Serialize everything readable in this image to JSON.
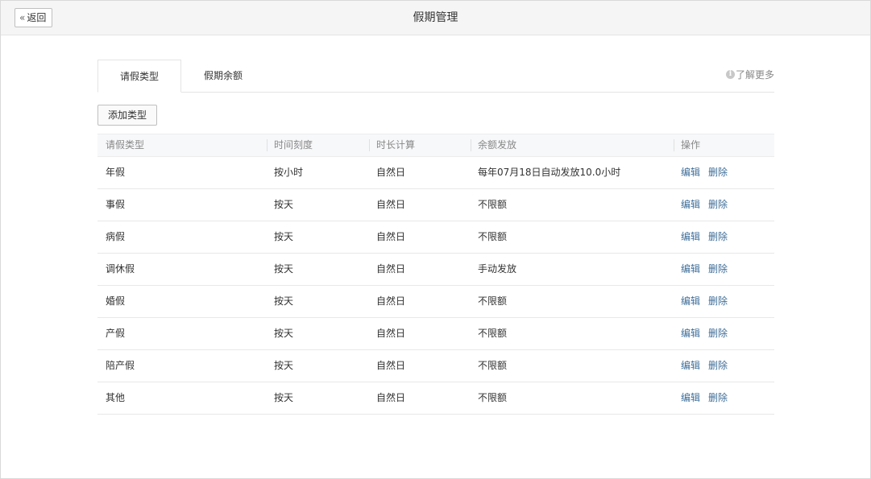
{
  "header": {
    "back_label": "返回",
    "title": "假期管理"
  },
  "tabs": [
    {
      "label": "请假类型",
      "active": true
    },
    {
      "label": "假期余额",
      "active": false
    }
  ],
  "learn_more": "了解更多",
  "add_type_label": "添加类型",
  "table": {
    "columns": [
      "请假类型",
      "时间刻度",
      "时长计算",
      "余额发放",
      "操作"
    ],
    "rows": [
      {
        "type": "年假",
        "scale": "按小时",
        "calc": "自然日",
        "balance": "每年07月18日自动发放10.0小时",
        "edit": "编辑",
        "delete": "删除"
      },
      {
        "type": "事假",
        "scale": "按天",
        "calc": "自然日",
        "balance": "不限额",
        "edit": "编辑",
        "delete": "删除"
      },
      {
        "type": "病假",
        "scale": "按天",
        "calc": "自然日",
        "balance": "不限额",
        "edit": "编辑",
        "delete": "删除"
      },
      {
        "type": "调休假",
        "scale": "按天",
        "calc": "自然日",
        "balance": "手动发放",
        "edit": "编辑",
        "delete": "删除"
      },
      {
        "type": "婚假",
        "scale": "按天",
        "calc": "自然日",
        "balance": "不限额",
        "edit": "编辑",
        "delete": "删除"
      },
      {
        "type": "产假",
        "scale": "按天",
        "calc": "自然日",
        "balance": "不限额",
        "edit": "编辑",
        "delete": "删除"
      },
      {
        "type": "陪产假",
        "scale": "按天",
        "calc": "自然日",
        "balance": "不限额",
        "edit": "编辑",
        "delete": "删除"
      },
      {
        "type": "其他",
        "scale": "按天",
        "calc": "自然日",
        "balance": "不限额",
        "edit": "编辑",
        "delete": "删除"
      }
    ]
  },
  "colors": {
    "link": "#3f6e99",
    "header_bg": "#f5f5f5",
    "table_head_bg": "#f7f8fa"
  }
}
